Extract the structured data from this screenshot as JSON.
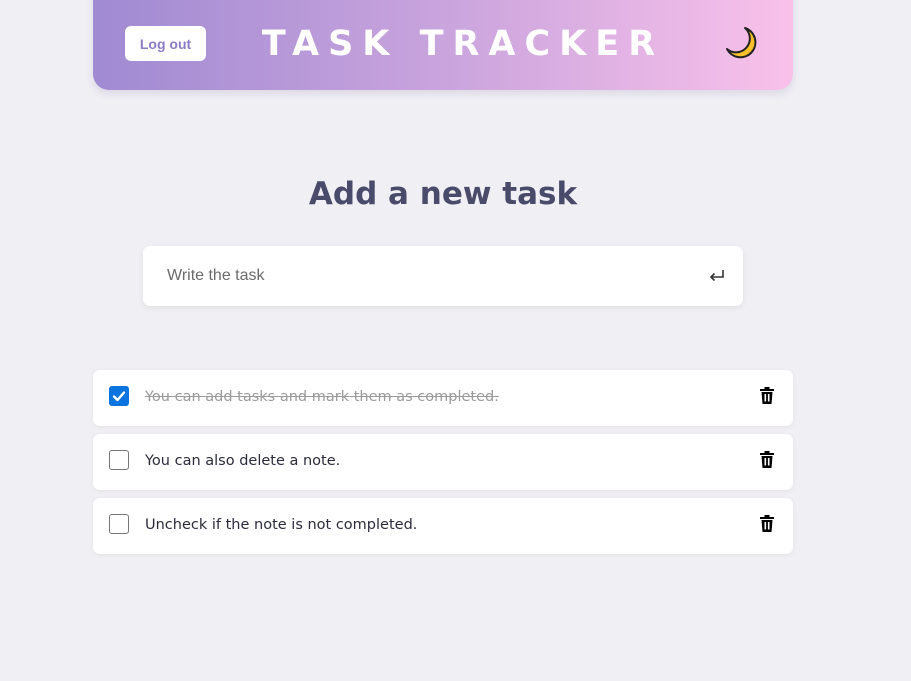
{
  "header": {
    "logout_label": "Log out",
    "title": "TASK TRACKER",
    "theme_icon": "moon-icon"
  },
  "new_task": {
    "heading": "Add a new task",
    "input_placeholder": "Write the task",
    "input_value": "",
    "submit_icon": "enter-icon"
  },
  "tasks": [
    {
      "text": "You can add tasks and mark them as completed.",
      "completed": true
    },
    {
      "text": "You can also delete a note.",
      "completed": false
    },
    {
      "text": "Uncheck if the note is not completed.",
      "completed": false
    }
  ],
  "colors": {
    "gradient_start": "#a08ad2",
    "gradient_end": "#f9c1ea",
    "checkbox_checked": "#0b74de",
    "background": "#f0eff4"
  }
}
